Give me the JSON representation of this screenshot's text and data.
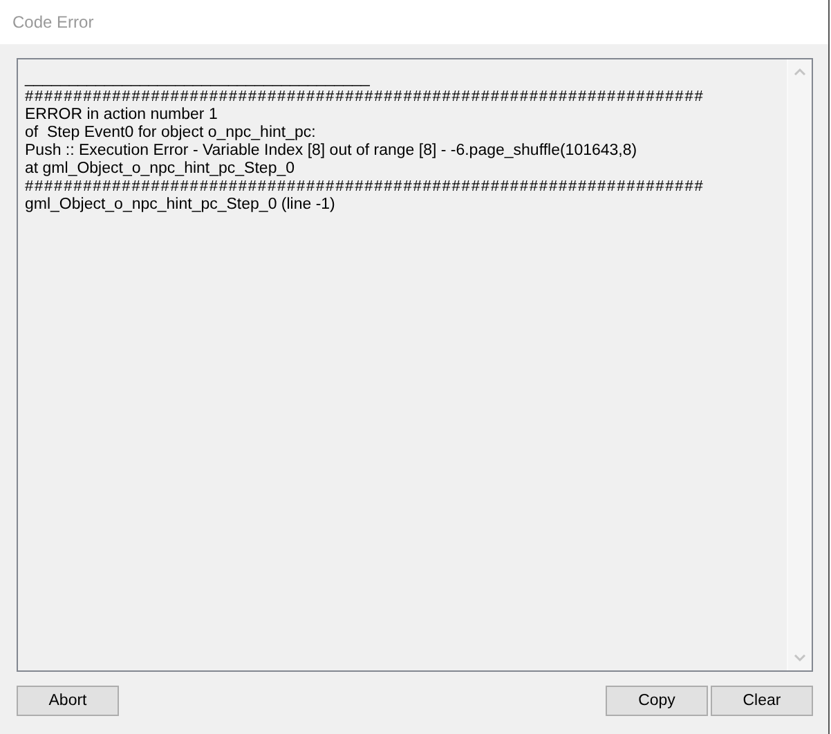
{
  "window": {
    "title": "Code Error"
  },
  "log_lines": [
    "_______________________________________",
    "######################################################################",
    "ERROR in action number 1",
    "of  Step Event0 for object o_npc_hint_pc:",
    "Push :: Execution Error - Variable Index [8] out of range [8] - -6.page_shuffle(101643,8)",
    "at gml_Object_o_npc_hint_pc_Step_0",
    "######################################################################",
    "gml_Object_o_npc_hint_pc_Step_0 (line -1)"
  ],
  "buttons_left": [
    "Abort"
  ],
  "buttons_right": [
    "Copy",
    "Clear"
  ]
}
